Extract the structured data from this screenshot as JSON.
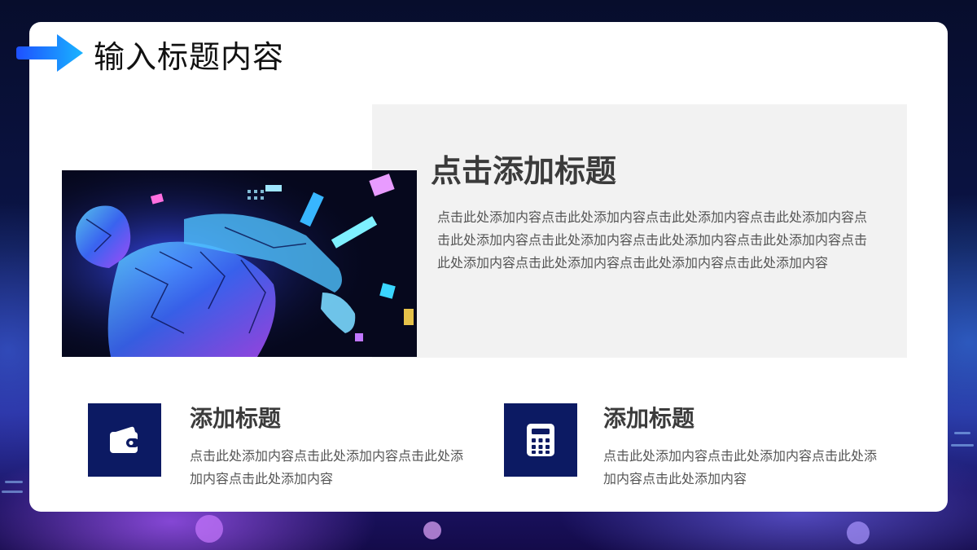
{
  "slide": {
    "title": "输入标题内容",
    "accent_color": "#1e8cff",
    "icon_box_color": "#0c1a63"
  },
  "feature": {
    "image_name": "digital-human-illustration",
    "heading": "点击添加标题",
    "body": "点击此处添加内容点击此处添加内容点击此处添加内容点击此处添加内容点击此处添加内容点击此处添加内容点击此处添加内容点击此处添加内容点击此处添加内容点击此处添加内容点击此处添加内容点击此处添加内容"
  },
  "cards": [
    {
      "icon": "wallet-icon",
      "heading": "添加标题",
      "body": "点击此处添加内容点击此处添加内容点击此处添加内容点击此处添加内容"
    },
    {
      "icon": "calculator-icon",
      "heading": "添加标题",
      "body": "点击此处添加内容点击此处添加内容点击此处添加内容点击此处添加内容"
    }
  ]
}
